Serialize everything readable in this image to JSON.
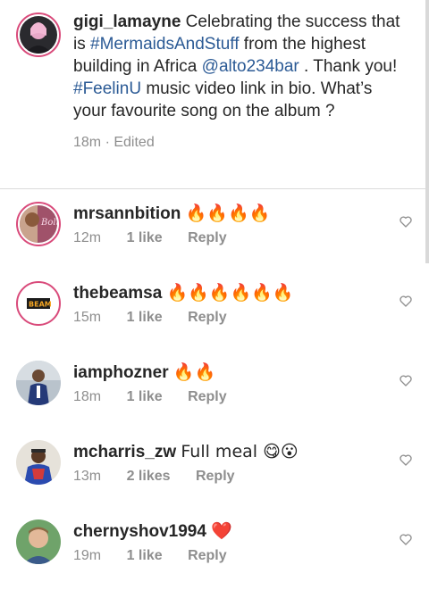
{
  "caption": {
    "username": "gigi_lamayne",
    "text_1": " Celebrating the success that is ",
    "hashtag_1": "#MermaidsAndStuff",
    "text_2": " from the highest building in Africa ",
    "mention": "@alto234bar",
    "text_3": " . Thank you! ",
    "hashtag_2": "#FeelinU",
    "text_4": " music video link in bio. What’s your favourite song on the album ?",
    "time": "18m",
    "separator": "·",
    "edited": "Edited"
  },
  "comments": [
    {
      "username": "mrsannbition",
      "text": "🔥🔥🔥🔥",
      "time": "12m",
      "likes": "1 like",
      "reply": "Reply"
    },
    {
      "username": "thebeamsa",
      "text": "🔥🔥🔥🔥🔥🔥",
      "time": "15m",
      "likes": "1 like",
      "reply": "Reply"
    },
    {
      "username": "iamphozner",
      "text": "🔥🔥",
      "time": "18m",
      "likes": "1 like",
      "reply": "Reply"
    },
    {
      "username": "mcharris_zw",
      "text": "Full meal 😋😮",
      "time": "13m",
      "likes": "2 likes",
      "reply": "Reply"
    },
    {
      "username": "chernyshov1994",
      "text": "❤️",
      "time": "19m",
      "likes": "1 like",
      "reply": "Reply"
    }
  ],
  "avatar_logo_text": "BEAM",
  "colors": {
    "link": "#2b5a95",
    "meta": "#8e8e8e",
    "divider": "#dbdbdb",
    "story_ring": "#d94b7b"
  },
  "icons": {
    "like": "heart-outline-icon"
  }
}
